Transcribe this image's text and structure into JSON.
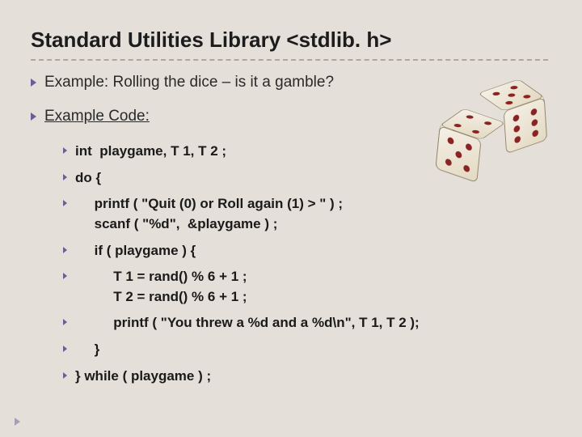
{
  "title": "Standard Utilities Library <stdlib. h>",
  "bullet1": "Example:  Rolling the dice – is it a gamble?",
  "bullet2": "Example Code:",
  "code": {
    "l1": "int  playgame, T 1, T 2 ;",
    "l2": "do {",
    "l3": "     printf ( \"Quit (0) or Roll again (1) > \" ) ;\n     scanf ( \"%d\",  &playgame ) ;",
    "l4": "     if ( playgame ) {",
    "l5": "          T 1 = rand() % 6 + 1 ;\n          T 2 = rand() % 6 + 1 ;",
    "l6": "          printf ( \"You threw a %d and a %d\\n\", T 1, T 2 );",
    "l7": "     }",
    "l8": "} while ( playgame ) ;"
  }
}
